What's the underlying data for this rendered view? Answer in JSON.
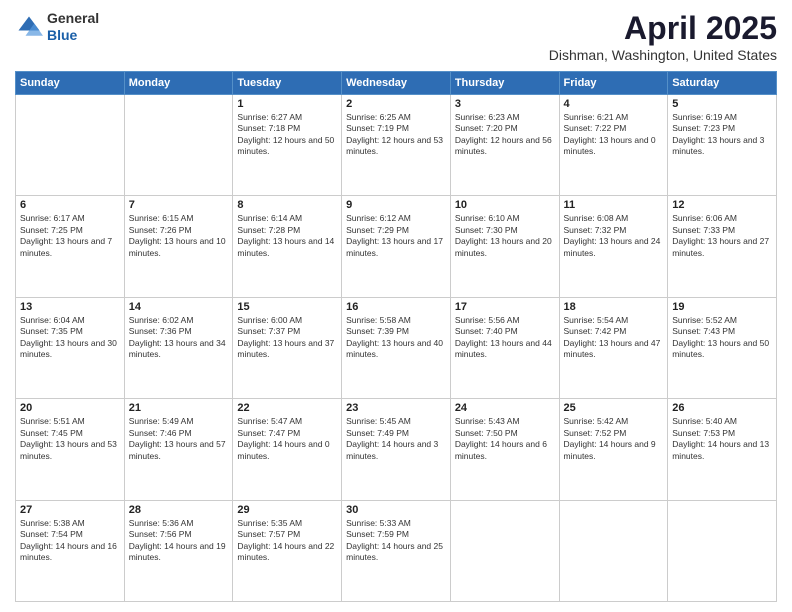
{
  "header": {
    "logo_general": "General",
    "logo_blue": "Blue",
    "title": "April 2025",
    "subtitle": "Dishman, Washington, United States"
  },
  "weekdays": [
    "Sunday",
    "Monday",
    "Tuesday",
    "Wednesday",
    "Thursday",
    "Friday",
    "Saturday"
  ],
  "weeks": [
    [
      {
        "day": "",
        "info": ""
      },
      {
        "day": "",
        "info": ""
      },
      {
        "day": "1",
        "info": "Sunrise: 6:27 AM\nSunset: 7:18 PM\nDaylight: 12 hours and 50 minutes."
      },
      {
        "day": "2",
        "info": "Sunrise: 6:25 AM\nSunset: 7:19 PM\nDaylight: 12 hours and 53 minutes."
      },
      {
        "day": "3",
        "info": "Sunrise: 6:23 AM\nSunset: 7:20 PM\nDaylight: 12 hours and 56 minutes."
      },
      {
        "day": "4",
        "info": "Sunrise: 6:21 AM\nSunset: 7:22 PM\nDaylight: 13 hours and 0 minutes."
      },
      {
        "day": "5",
        "info": "Sunrise: 6:19 AM\nSunset: 7:23 PM\nDaylight: 13 hours and 3 minutes."
      }
    ],
    [
      {
        "day": "6",
        "info": "Sunrise: 6:17 AM\nSunset: 7:25 PM\nDaylight: 13 hours and 7 minutes."
      },
      {
        "day": "7",
        "info": "Sunrise: 6:15 AM\nSunset: 7:26 PM\nDaylight: 13 hours and 10 minutes."
      },
      {
        "day": "8",
        "info": "Sunrise: 6:14 AM\nSunset: 7:28 PM\nDaylight: 13 hours and 14 minutes."
      },
      {
        "day": "9",
        "info": "Sunrise: 6:12 AM\nSunset: 7:29 PM\nDaylight: 13 hours and 17 minutes."
      },
      {
        "day": "10",
        "info": "Sunrise: 6:10 AM\nSunset: 7:30 PM\nDaylight: 13 hours and 20 minutes."
      },
      {
        "day": "11",
        "info": "Sunrise: 6:08 AM\nSunset: 7:32 PM\nDaylight: 13 hours and 24 minutes."
      },
      {
        "day": "12",
        "info": "Sunrise: 6:06 AM\nSunset: 7:33 PM\nDaylight: 13 hours and 27 minutes."
      }
    ],
    [
      {
        "day": "13",
        "info": "Sunrise: 6:04 AM\nSunset: 7:35 PM\nDaylight: 13 hours and 30 minutes."
      },
      {
        "day": "14",
        "info": "Sunrise: 6:02 AM\nSunset: 7:36 PM\nDaylight: 13 hours and 34 minutes."
      },
      {
        "day": "15",
        "info": "Sunrise: 6:00 AM\nSunset: 7:37 PM\nDaylight: 13 hours and 37 minutes."
      },
      {
        "day": "16",
        "info": "Sunrise: 5:58 AM\nSunset: 7:39 PM\nDaylight: 13 hours and 40 minutes."
      },
      {
        "day": "17",
        "info": "Sunrise: 5:56 AM\nSunset: 7:40 PM\nDaylight: 13 hours and 44 minutes."
      },
      {
        "day": "18",
        "info": "Sunrise: 5:54 AM\nSunset: 7:42 PM\nDaylight: 13 hours and 47 minutes."
      },
      {
        "day": "19",
        "info": "Sunrise: 5:52 AM\nSunset: 7:43 PM\nDaylight: 13 hours and 50 minutes."
      }
    ],
    [
      {
        "day": "20",
        "info": "Sunrise: 5:51 AM\nSunset: 7:45 PM\nDaylight: 13 hours and 53 minutes."
      },
      {
        "day": "21",
        "info": "Sunrise: 5:49 AM\nSunset: 7:46 PM\nDaylight: 13 hours and 57 minutes."
      },
      {
        "day": "22",
        "info": "Sunrise: 5:47 AM\nSunset: 7:47 PM\nDaylight: 14 hours and 0 minutes."
      },
      {
        "day": "23",
        "info": "Sunrise: 5:45 AM\nSunset: 7:49 PM\nDaylight: 14 hours and 3 minutes."
      },
      {
        "day": "24",
        "info": "Sunrise: 5:43 AM\nSunset: 7:50 PM\nDaylight: 14 hours and 6 minutes."
      },
      {
        "day": "25",
        "info": "Sunrise: 5:42 AM\nSunset: 7:52 PM\nDaylight: 14 hours and 9 minutes."
      },
      {
        "day": "26",
        "info": "Sunrise: 5:40 AM\nSunset: 7:53 PM\nDaylight: 14 hours and 13 minutes."
      }
    ],
    [
      {
        "day": "27",
        "info": "Sunrise: 5:38 AM\nSunset: 7:54 PM\nDaylight: 14 hours and 16 minutes."
      },
      {
        "day": "28",
        "info": "Sunrise: 5:36 AM\nSunset: 7:56 PM\nDaylight: 14 hours and 19 minutes."
      },
      {
        "day": "29",
        "info": "Sunrise: 5:35 AM\nSunset: 7:57 PM\nDaylight: 14 hours and 22 minutes."
      },
      {
        "day": "30",
        "info": "Sunrise: 5:33 AM\nSunset: 7:59 PM\nDaylight: 14 hours and 25 minutes."
      },
      {
        "day": "",
        "info": ""
      },
      {
        "day": "",
        "info": ""
      },
      {
        "day": "",
        "info": ""
      }
    ]
  ]
}
